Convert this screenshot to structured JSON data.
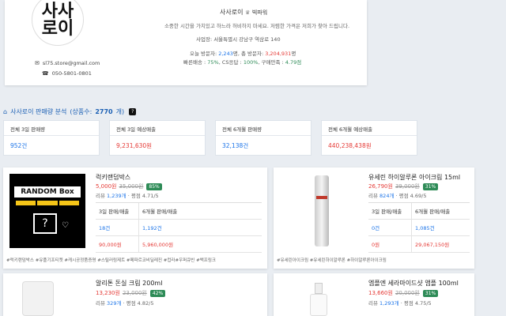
{
  "store": {
    "logo_text": "사사\n로이",
    "email": "sl75.store@gmail.com",
    "phone": "050-5801-0801",
    "name": "사사로이",
    "name_suffix": "빅파워",
    "desc": "소중한 시간을 가치있고 하느라 허비하지 마세요. 저렴한 가격은 저희가 찾아 드립니다.",
    "addr": "사업장: 서울특별시 강남구 역삼로 140",
    "today_label": "오늘 방문자:",
    "today_val": "2,243",
    "today_unit": "명, 총 방문자:",
    "total_val": "3,204,931",
    "total_unit": "명",
    "delivery_label": "빠른배송 :",
    "delivery_val": "75%",
    "cs_label": ", CS응답 :",
    "cs_val": "100%",
    "satis_label": ", 구매만족 :",
    "satis_val": "4.79점"
  },
  "section": {
    "title": "사사로이 판매량 분석",
    "count_label": "(상품수:",
    "count_val": "2770",
    "count_close": "개)",
    "badge": "?"
  },
  "stats": [
    {
      "label": "전체 3일 판매량",
      "value": "952건",
      "color": "#1a73e8"
    },
    {
      "label": "전체 3일 예상매출",
      "value": "9,231,630원",
      "color": "#e53935"
    },
    {
      "label": "전체 6개월 판매량",
      "value": "32,138건",
      "color": "#1a73e8"
    },
    {
      "label": "전체 6개월 예상매출",
      "value": "440,238,438원",
      "color": "#e53935"
    }
  ],
  "products": [
    {
      "name": "럭키랜덤박스",
      "sale": "5,000원",
      "orig": "35,000원",
      "disc": "85%",
      "review_label": "리뷰",
      "review_cnt": "1,239개",
      "review_rest": "· 평점 4.71/5",
      "h1": "3일 판매/매출",
      "h2": "6개월 판매/매출",
      "r1c1": "18건",
      "r1c2": "1,192건",
      "r2c1": "90,000원",
      "r2c2": "5,960,000원",
      "tags": "#럭키랜덤박스 #유플기프티켓 #캐시공정품증명 #스틸러링제트 #페파르코비딜레진 #컵라#우퍼큐빈 #백프링크",
      "box_text": "RANDOM Box"
    },
    {
      "name": "유세린 하이알루론 아이크림 15ml",
      "sale": "26,790원",
      "orig": "39,000원",
      "disc": "31%",
      "review_label": "리뷰",
      "review_cnt": "824개",
      "review_rest": "· 평점 4.69/5",
      "h1": "3일 판매/매출",
      "h2": "6개월 판매/매출",
      "r1c1": "0건",
      "r1c2": "1,085건",
      "r2c1": "0원",
      "r2c2": "29,067,150원",
      "tags": "#유세린아이크림 #유세린하이알루론 #하이알루론아이크림"
    },
    {
      "name": "알리톤 돈실 크림 200ml",
      "sale": "13,230원",
      "orig": "23,000원",
      "disc": "42%",
      "review_label": "리뷰",
      "review_cnt": "329개",
      "review_rest": "· 평점 4.82/5"
    },
    {
      "name": "엠플엔 세라마이드샷 앰플 100ml",
      "sale": "13,660원",
      "orig": "20,000원",
      "disc": "31%",
      "review_label": "리뷰",
      "review_cnt": "1,293개",
      "review_rest": "· 평점 4.75/5"
    }
  ]
}
